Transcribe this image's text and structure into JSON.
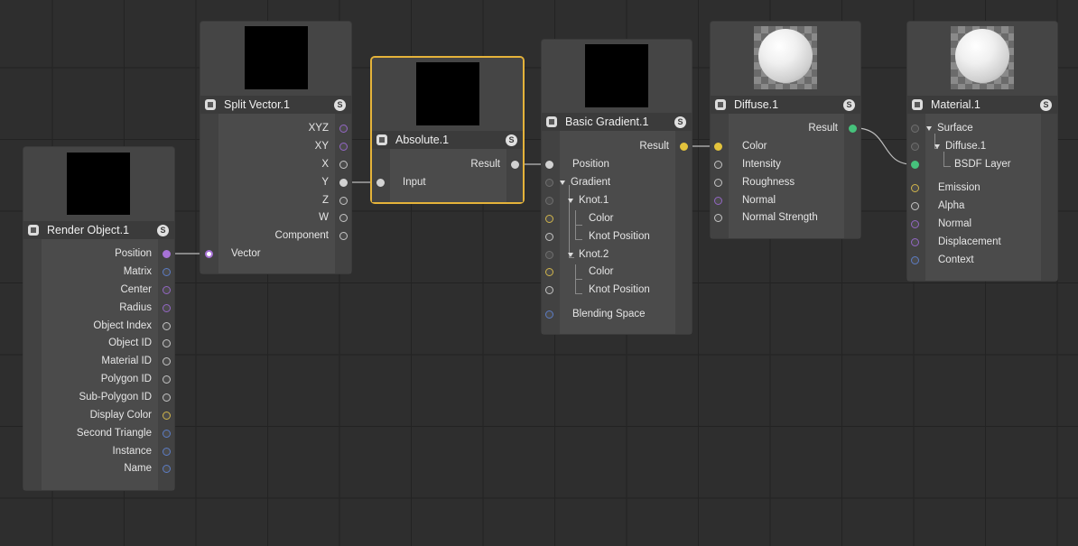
{
  "nodes": {
    "render_object": {
      "title": "Render Object.1",
      "outputs": [
        "Position",
        "Matrix",
        "Center",
        "Radius",
        "Object Index",
        "Object ID",
        "Material ID",
        "Polygon ID",
        "Sub-Polygon ID",
        "Display Color",
        "Second Triangle",
        "Instance",
        "Name"
      ]
    },
    "split_vector": {
      "title": "Split Vector.1",
      "outputs": [
        "XYZ",
        "XY",
        "X",
        "Y",
        "Z",
        "W",
        "Component"
      ],
      "inputs": [
        "Vector"
      ]
    },
    "absolute": {
      "title": "Absolute.1",
      "outputs": [
        "Result"
      ],
      "inputs": [
        "Input"
      ]
    },
    "basic_gradient": {
      "title": "Basic Gradient.1",
      "outputs": [
        "Result"
      ],
      "inputs": {
        "position": "Position",
        "gradient": "Gradient",
        "knot1": "Knot.1",
        "knot1_color": "Color",
        "knot1_position": "Knot Position",
        "knot2": "Knot.2",
        "knot2_color": "Color",
        "knot2_position": "Knot Position",
        "blending_space": "Blending Space"
      }
    },
    "diffuse": {
      "title": "Diffuse.1",
      "outputs": [
        "Result"
      ],
      "inputs": [
        "Color",
        "Intensity",
        "Roughness",
        "Normal",
        "Normal Strength"
      ]
    },
    "material": {
      "title": "Material.1",
      "inputs": {
        "surface": "Surface",
        "diffuse": "Diffuse.1",
        "bsdf": "BSDF Layer",
        "emission": "Emission",
        "alpha": "Alpha",
        "normal": "Normal",
        "displacement": "Displacement",
        "context": "Context"
      }
    }
  },
  "badge_letter": "S",
  "colors": {
    "canvas": "#2e2e2e",
    "node": "#4b4b4b",
    "header": "#3b3b3b",
    "selected": "#e5b33a",
    "vector_port": "#a772d6",
    "color_port": "#e3c33c",
    "bsdf_port": "#46c27c",
    "context_port": "#5b7cc5"
  }
}
